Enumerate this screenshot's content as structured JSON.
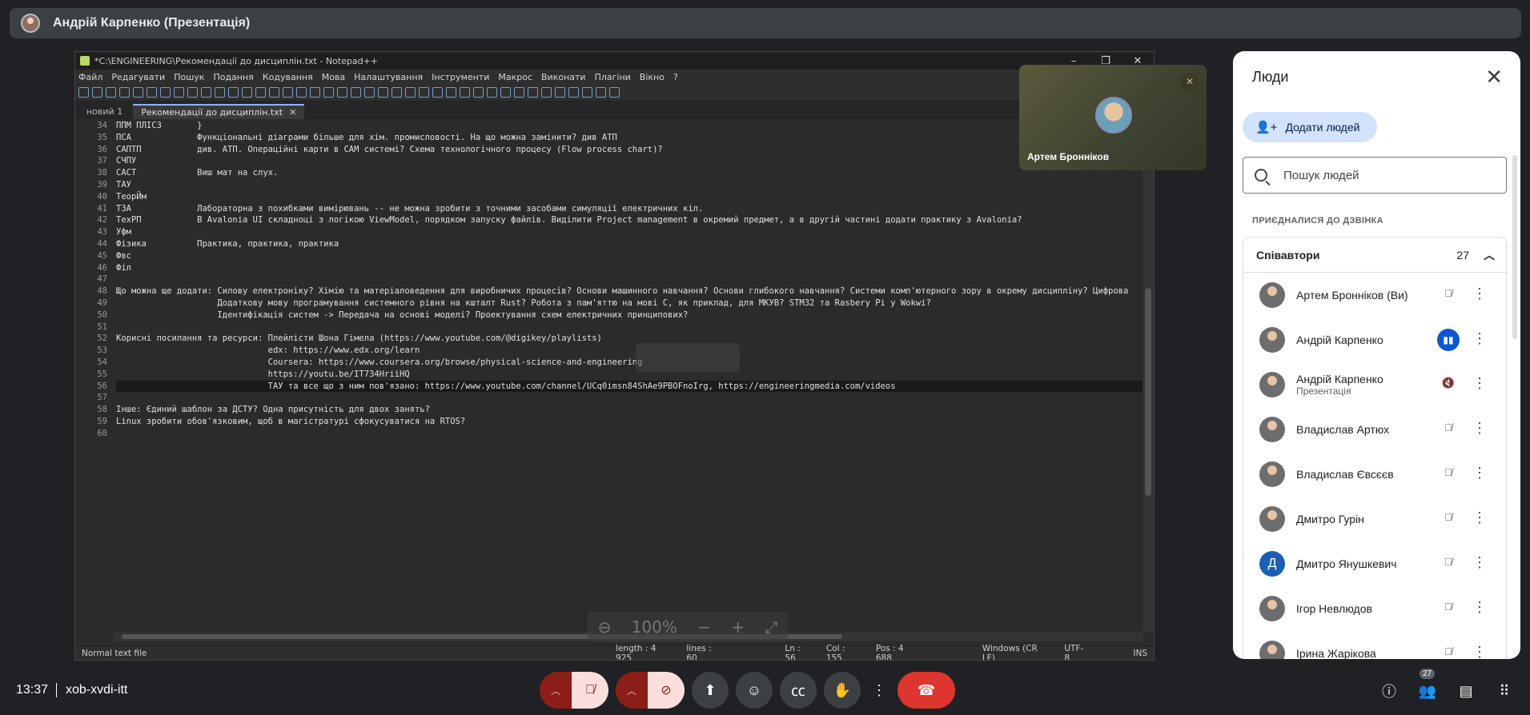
{
  "presenter": {
    "name": "Андрій Карпенко (Презентація)"
  },
  "notepad": {
    "title": "*C:\\ENGINEERING\\Рекомендації до дисциплін.txt - Notepad++",
    "menu": [
      "Файл",
      "Редагувати",
      "Пошук",
      "Подання",
      "Кодування",
      "Мова",
      "Налаштування",
      "Інструменти",
      "Макрос",
      "Виконати",
      "Плагіни",
      "Вікно",
      "?"
    ],
    "tabs": [
      {
        "label": "новий 1"
      },
      {
        "label": "Рекомендації до дисциплін.txt"
      }
    ],
    "lines": [
      {
        "n": "34",
        "text": "ППМ ПЛІС3       }"
      },
      {
        "n": "35",
        "text": "ПСА             Функціональні діаграми більше для хім. промисловості. На що можна замінити? див АТП"
      },
      {
        "n": "36",
        "text": "САПТП           див. АТП. Операційні карти в CAM системі? Схема технологічного процесу (Flow process chart)?"
      },
      {
        "n": "37",
        "text": "СЧПУ"
      },
      {
        "n": "38",
        "text": "САСТ            Виш мат на слух."
      },
      {
        "n": "39",
        "text": "ТАУ"
      },
      {
        "n": "40",
        "text": "ТеорЙм"
      },
      {
        "n": "41",
        "text": "ТЗА             Лабораторна з похибками вимірювань -- не можна зробити з точними засобами симуляції електричних кіл."
      },
      {
        "n": "42",
        "text": "ТехРП           В Avalonia UI складноці з логікою ViewModel, порядком запуску файлів. Виділити Project management в окремий предмет, а в другій частині додати практику з Avalonia?"
      },
      {
        "n": "43",
        "text": "Уфм"
      },
      {
        "n": "44",
        "text": "Фізика          Практика, практика, практика"
      },
      {
        "n": "45",
        "text": "Фвс"
      },
      {
        "n": "46",
        "text": "Філ"
      },
      {
        "n": "47",
        "text": ""
      },
      {
        "n": "48",
        "text": "Що можна ще додати: Силову електроніку? Хімію та матеріаловедення для виробничих процесів? Основи машинного навчання? Основи глибокого навчання? Системи комп'ютерного зору в окрему дисципліну? Цифрова"
      },
      {
        "n": "49",
        "text": "                    Додаткову мову програмування системного рівня на кшталт Rust? Робота з пам'яттю на мові C, як приклад, для МКУВ? STM32 та Rasbery Pi у Wokwi?"
      },
      {
        "n": "50",
        "text": "                    Ідентифікація систем -> Передача на основі моделі? Проектування схем електричних принципових?"
      },
      {
        "n": "51",
        "text": ""
      },
      {
        "n": "52",
        "text": "Корисні посилання та ресурси: Плейлісти Шона Гімела (https://www.youtube.com/@digikey/playlists)"
      },
      {
        "n": "53",
        "text": "                              edx: https://www.edx.org/learn"
      },
      {
        "n": "54",
        "text": "                              Coursera: https://www.coursera.org/browse/physical-science-and-engineering"
      },
      {
        "n": "55",
        "text": "                              https://youtu.be/IT734HriiHQ"
      },
      {
        "n": "56",
        "text": "                              ТАУ та все що з ним пов'язано: https://www.youtube.com/channel/UCq0imsn84ShAe9PBOFnoIrg, https://engineeringmedia.com/videos"
      },
      {
        "n": "57",
        "text": ""
      },
      {
        "n": "58",
        "text": "Інше: Єдиний шаблон за ДСТУ? Одна присутність для двох занять?"
      },
      {
        "n": "59",
        "text": "Linux зробити обов'язковим, щоб в магістратурі сфокусуватися на RTOS?"
      },
      {
        "n": "60",
        "text": ""
      }
    ],
    "status": {
      "type": "Normal text file",
      "length": "length : 4 925",
      "lines": "lines : 60",
      "ln": "Ln : 56",
      "col": "Col : 155",
      "pos": "Pos : 4 688",
      "eol": "Windows (CR LF)",
      "enc": "UTF-8",
      "mode": "INS"
    },
    "zoom": "100%"
  },
  "self_tile": {
    "name": "Артем Бронніков"
  },
  "people_panel": {
    "title": "Люди",
    "add_label": "Додати людей",
    "search_placeholder": "Пошук людей",
    "section": "ПРИЄДНАЛИСЯ ДО ДЗВІНКА",
    "group_label": "Співавтори",
    "group_count": "27",
    "people": [
      {
        "name": "Артем Бронніков (Ви)",
        "sub": "",
        "mic": "muted"
      },
      {
        "name": "Андрій Карпенко",
        "sub": "",
        "mic": "speaking"
      },
      {
        "name": "Андрій Карпенко",
        "sub": "Презентація",
        "mic": "sound-off"
      },
      {
        "name": "Владислав Артюх",
        "sub": "",
        "mic": "muted"
      },
      {
        "name": "Владислав Євсєєв",
        "sub": "",
        "mic": "muted"
      },
      {
        "name": "Дмитро Гурін",
        "sub": "",
        "mic": "muted"
      },
      {
        "name": "Дмитро Янушкевич",
        "sub": "",
        "mic": "muted",
        "letter": "Д"
      },
      {
        "name": "Ігор Невлюдов",
        "sub": "",
        "mic": "muted"
      },
      {
        "name": "Ірина Жарікова",
        "sub": "",
        "mic": "muted"
      }
    ]
  },
  "bottom": {
    "time": "13:37",
    "meeting_code": "xob-xvdi-itt",
    "people_badge": "27"
  }
}
